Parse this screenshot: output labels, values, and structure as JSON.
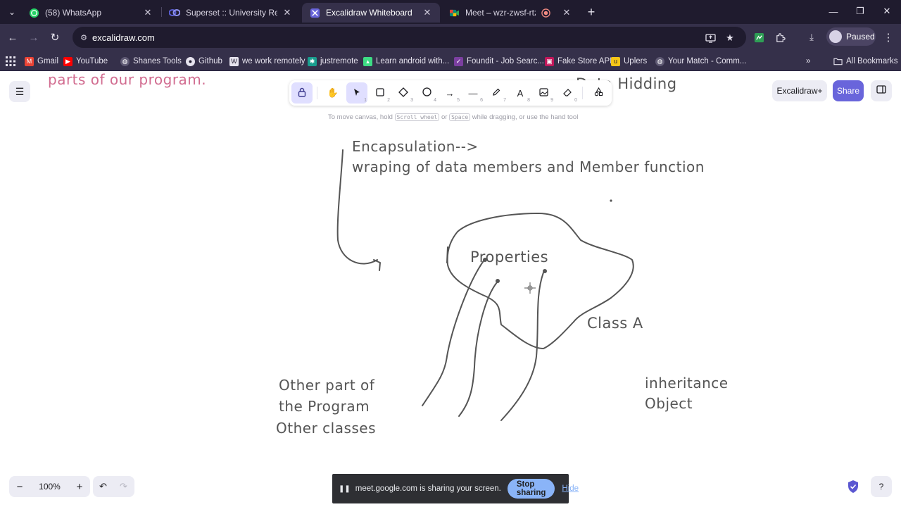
{
  "browser": {
    "tabs": [
      {
        "title": "(58) WhatsApp",
        "icon": "whatsapp-icon",
        "active": false
      },
      {
        "title": "Superset :: University Recruiting",
        "icon": "superset-icon",
        "active": false
      },
      {
        "title": "Excalidraw Whiteboard",
        "icon": "excalidraw-icon",
        "active": true
      },
      {
        "title": "Meet – wzr-zwsf-rtz",
        "icon": "meet-icon",
        "active": false
      }
    ],
    "url": "excalidraw.com",
    "profile_status": "Paused",
    "bookmarks": [
      "Gmail",
      "YouTube",
      "Shanes Tools",
      "Github",
      "we work remotely",
      "justremote",
      "Learn android with...",
      "Foundit - Job Searc...",
      "Fake Store API",
      "Uplers",
      "Your Match - Comm..."
    ],
    "all_bookmarks": "All Bookmarks"
  },
  "excalidraw": {
    "toolbar_keys": [
      "1",
      "2",
      "3",
      "4",
      "5",
      "6",
      "7",
      "8",
      "9",
      "0"
    ],
    "hint": {
      "part1": "To move canvas, hold",
      "key1": "Scroll wheel",
      "part2": "or",
      "key2": "Space",
      "part3": "while dragging, or use the hand tool"
    },
    "excalidraw_plus": "Excalidraw+",
    "share": "Share",
    "zoom": "100%"
  },
  "drawing": {
    "top_left_text": "parts of our program.",
    "top_right_text": "Data Hidding",
    "encapsulation_title": "Encapsulation-->",
    "encapsulation_desc": "wraping of data members and Member function",
    "properties": "Properties",
    "class_label": "Class A",
    "other_line1": "Other part of",
    "other_line2": "the Program",
    "other_line3": "Other classes",
    "inheritance_line1": "inheritance",
    "inheritance_line2": "Object"
  },
  "screen_share": {
    "message": "meet.google.com is sharing your screen.",
    "stop": "Stop sharing",
    "hide": "Hide"
  },
  "colors": {
    "accent": "#6965db",
    "ink": "#555555",
    "pink_text": "#d16b8f",
    "chrome_bg": "#1f1b2e"
  }
}
